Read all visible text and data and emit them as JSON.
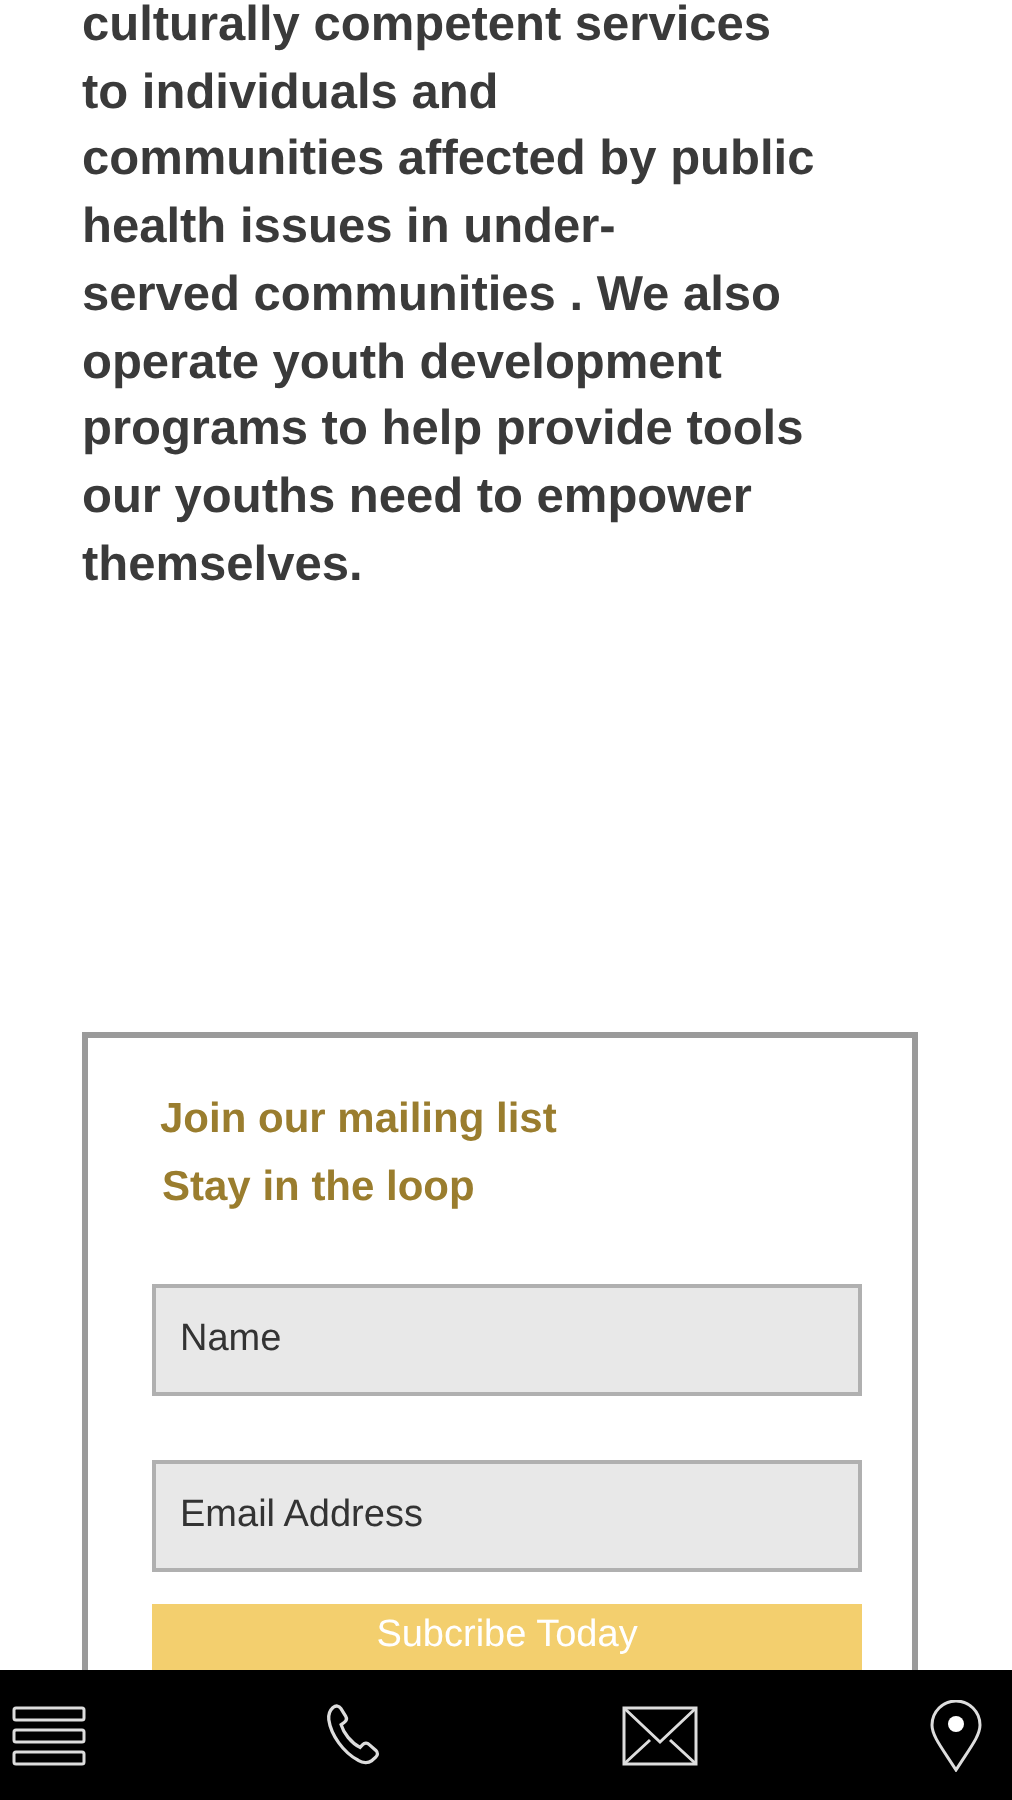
{
  "intro": {
    "lines": [
      "culturally competent services",
      "to individuals and",
      "communities affected by public",
      "health issues in under-",
      "served communities . We also",
      "operate youth development",
      "programs to help provide tools",
      "our youths need to empower",
      "themselves."
    ]
  },
  "mailing": {
    "title": "Join our mailing list",
    "subtitle": "Stay in the loop",
    "fields": [
      {
        "placeholder": "Name"
      },
      {
        "placeholder": "Email Address"
      }
    ],
    "button": "Subcribe Today"
  },
  "bottom_bar": [
    {
      "kind": "menu"
    },
    {
      "kind": "phone"
    },
    {
      "kind": "mail"
    },
    {
      "kind": "location"
    }
  ]
}
